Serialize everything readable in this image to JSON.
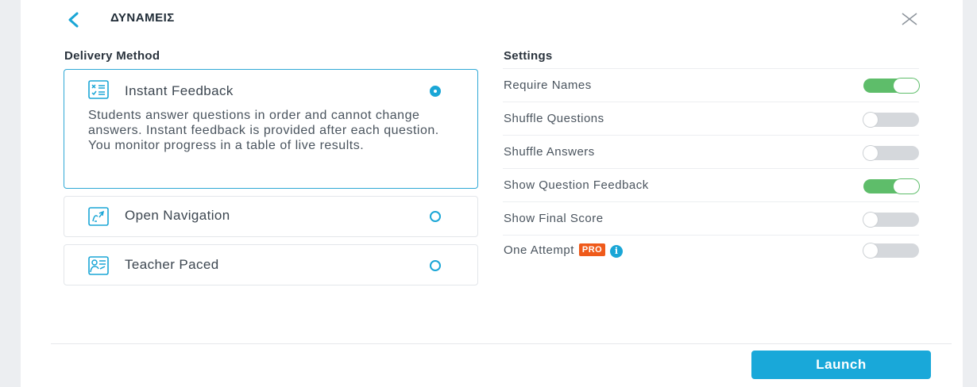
{
  "header": {
    "title": "ΔΥΝΑΜΕΙΣ"
  },
  "delivery": {
    "section_title": "Delivery Method",
    "options": [
      {
        "label": "Instant Feedback",
        "icon": "instant-feedback-icon",
        "selected": true,
        "description": "Students answer questions in order and cannot change answers. Instant feedback is provided after each question. You monitor progress in a table of live results."
      },
      {
        "label": "Open Navigation",
        "icon": "open-navigation-icon",
        "selected": false
      },
      {
        "label": "Teacher Paced",
        "icon": "teacher-paced-icon",
        "selected": false
      }
    ]
  },
  "settings": {
    "section_title": "Settings",
    "items": [
      {
        "label": "Require Names",
        "on": true
      },
      {
        "label": "Shuffle Questions",
        "on": false
      },
      {
        "label": "Shuffle Answers",
        "on": false
      },
      {
        "label": "Show Question Feedback",
        "on": true
      },
      {
        "label": "Show Final Score",
        "on": false
      },
      {
        "label": "One Attempt",
        "on": false,
        "badge": "PRO",
        "info": "i"
      }
    ]
  },
  "footer": {
    "launch_label": "Launch"
  },
  "colors": {
    "accent": "#19a8d9",
    "toggle_on": "#5ebd6a",
    "pro_badge": "#ef5a1a"
  }
}
